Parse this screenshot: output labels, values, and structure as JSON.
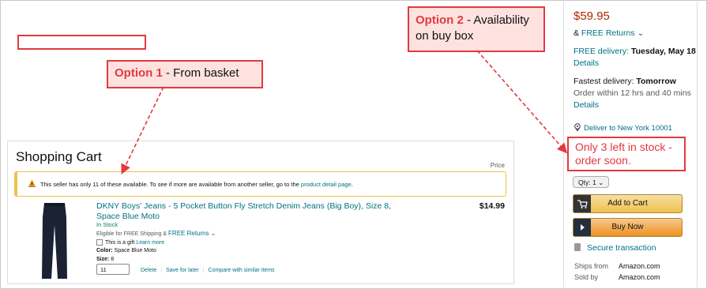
{
  "callouts": {
    "option1": {
      "label": "Option 1",
      "text": " - From basket"
    },
    "option2": {
      "label": "Option 2",
      "text": " - Availability on buy box"
    }
  },
  "cart": {
    "title": "Shopping Cart",
    "price_header": "Price",
    "warning": {
      "icon": "warning-icon",
      "highlight": "This seller has only 11 of these available.",
      "rest": " To see if more are available from another seller, go to the ",
      "link": "product detail page",
      "end": "."
    },
    "item": {
      "title": "DKNY Boys' Jeans - 5 Pocket Button Fly Stretch Denim Jeans (Big Boy), Size 8, Space Blue Moto",
      "price": "$14.99",
      "stock": "In Stock",
      "eligible": "Eligible for FREE Shipping & ",
      "free_returns": "FREE Returns",
      "gift": "This is a gift",
      "learn_more": "Learn more",
      "color_label": "Color:",
      "color_value": " Space Blue Moto",
      "size_label": "Size:",
      "size_value": " 8",
      "quantity": "11",
      "actions": [
        "Delete",
        "Save for later",
        "Compare with similar items"
      ]
    }
  },
  "buybox": {
    "price": "$59.95",
    "returns_prefix": "& ",
    "returns": "FREE Returns",
    "delivery_label": "FREE delivery:",
    "delivery_date": " Tuesday, May 18",
    "details": "Details",
    "fastest_label": "Fastest delivery:",
    "fastest_value": " Tomorrow",
    "order_within": "Order within 12 hrs and 40 mins",
    "deliver_to": "Deliver to New York 10001",
    "stock_notice": "Only 3 left in stock - order soon.",
    "qty": "Qty: 1",
    "add_to_cart": "Add to Cart",
    "buy_now": "Buy Now",
    "secure": "Secure transaction",
    "ships_from_label": "Ships from",
    "ships_from": "Amazon.com",
    "sold_by_label": "Sold by",
    "sold_by": "Amazon.com"
  },
  "colors": {
    "annotation_red": "#e3393f",
    "link": "#007185",
    "price_red": "#b12704",
    "button_yellow": "#f0c14b",
    "button_orange": "#ed9220"
  }
}
